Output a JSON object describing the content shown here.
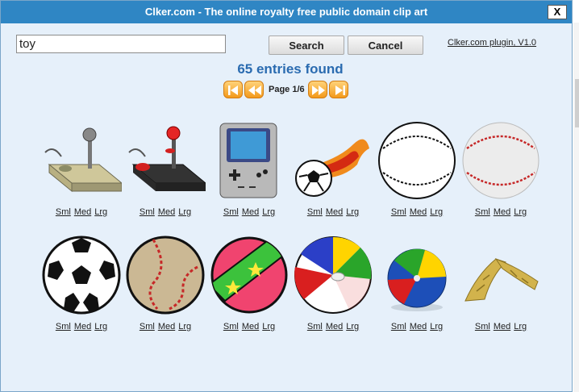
{
  "window": {
    "title": "Clker.com - The online royalty free public domain clip art",
    "close_label": "X"
  },
  "search": {
    "value": "toy",
    "search_label": "Search",
    "cancel_label": "Cancel",
    "plugin_link": "Clker.com plugin, V1.0"
  },
  "results": {
    "count_text": "65 entries found",
    "page_label": "Page 1/6"
  },
  "size_links": {
    "small": "Sml",
    "medium": "Med",
    "large": "Lrg"
  },
  "items": [
    {
      "icon": "joystick-beige-icon"
    },
    {
      "icon": "joystick-black-icon"
    },
    {
      "icon": "handheld-game-console-icon"
    },
    {
      "icon": "flaming-soccer-ball-icon"
    },
    {
      "icon": "baseball-outline-icon"
    },
    {
      "icon": "baseball-icon"
    },
    {
      "icon": "soccer-ball-icon"
    },
    {
      "icon": "worn-baseball-icon"
    },
    {
      "icon": "star-ball-icon"
    },
    {
      "icon": "beach-ball-icon"
    },
    {
      "icon": "small-beach-ball-icon"
    },
    {
      "icon": "boomerang-icon"
    }
  ],
  "colors": {
    "titlebar": "#2f86c4",
    "content_bg": "#e6f0fa",
    "count_text": "#2a6bb0",
    "pager_button": "#f39a1b"
  }
}
